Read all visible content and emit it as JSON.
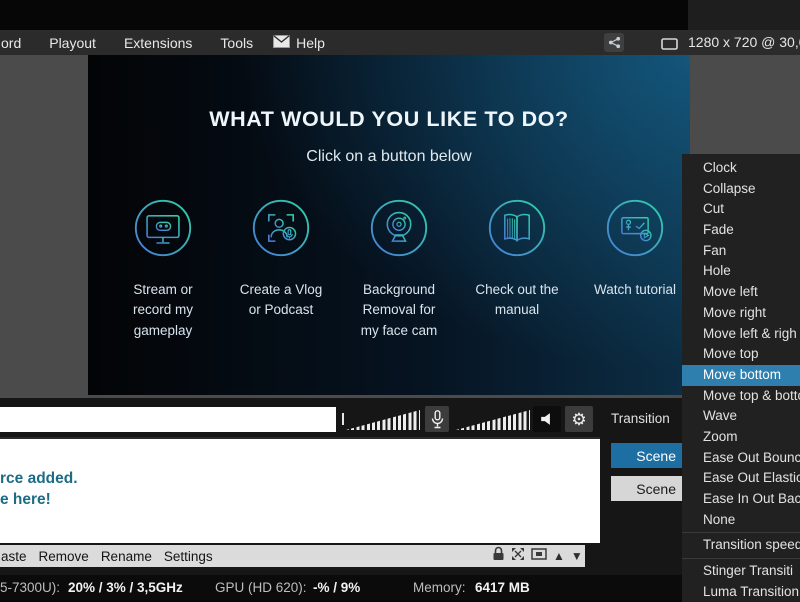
{
  "window": {
    "menu_items": [
      "ord",
      "Playout",
      "Extensions",
      "Tools",
      "Help"
    ],
    "resolution_text": "1280 x 720 @ 30,0"
  },
  "welcome": {
    "title": "WHAT WOULD YOU LIKE TO DO?",
    "subtitle": "Click on a button below",
    "actions": [
      {
        "icon": "gameplay-monitor-icon",
        "label": "Stream or\nrecord my\ngameplay"
      },
      {
        "icon": "vlog-person-mic-icon",
        "label": "Create a Vlog\nor Podcast"
      },
      {
        "icon": "webcam-icon",
        "label": "Background\nRemoval for\nmy face cam"
      },
      {
        "icon": "open-book-icon",
        "label": "Check out the\nmanual"
      },
      {
        "icon": "tutorial-play-icon",
        "label": "Watch tutorial"
      }
    ]
  },
  "context_menu": {
    "items": [
      "Clock",
      "Collapse",
      "Cut",
      "Fade",
      "Fan",
      "Hole",
      "Move left",
      "Move right",
      "Move left & righ",
      "Move top",
      "Move bottom",
      "Move top & botto",
      "Wave",
      "Zoom",
      "Ease Out Bounc",
      "Ease Out Elastic",
      "Ease In Out Bac",
      "None",
      "Transition speed",
      "Stinger Transiti",
      "Luma Transition"
    ],
    "highlighted_item": "Move bottom"
  },
  "transition_panel": {
    "label": "Transition",
    "scene_buttons": [
      "Scene",
      "Scene"
    ]
  },
  "source_area": {
    "line1": "rce added.",
    "line2": "e here!"
  },
  "toolbar": {
    "items": [
      "aste",
      "Remove",
      "Rename",
      "Settings"
    ]
  },
  "status_bar": {
    "cpu_label": "5-7300U):",
    "cpu_value": "20% / 3% / 3,5GHz",
    "gpu_label": "GPU (HD 620):",
    "gpu_value": "-% / 9%",
    "memory_label": "Memory:",
    "memory_value": "6417 MB"
  },
  "icons": {
    "gear": "⚙",
    "triangle_up": "▲",
    "triangle_down": "▼"
  },
  "colors": {
    "menu_highlight": "#2e7fae",
    "scene_active": "#1d6fa3",
    "source_text": "#1c6c85",
    "icon_gradient_start": "#4a7bd8",
    "icon_gradient_end": "#2fd1a6"
  }
}
